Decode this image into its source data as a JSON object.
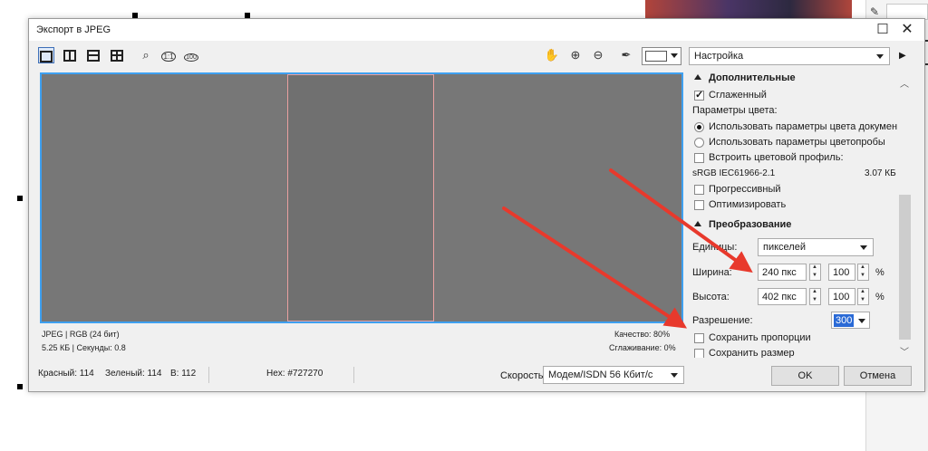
{
  "dialog": {
    "title": "Экспорт в JPEG",
    "close_label": "✕",
    "maximize_label": "☐"
  },
  "toolbar": {
    "preset": "Настройка",
    "icons": [
      "single-view-icon",
      "split-vertical-icon",
      "split-horizontal-icon",
      "quad-view-icon",
      "zoom-fit-icon",
      "zoom-1-1-icon",
      "zoom-100-icon",
      "pan-hand-icon",
      "zoom-in-icon",
      "zoom-out-icon",
      "eyedropper-icon"
    ],
    "zoom_1_1": "1:1",
    "zoom_100": "100"
  },
  "preview_info": {
    "format": "JPEG  |  RGB (24 бит)",
    "size": "5.25 КБ  |  Секунды: 0.8",
    "quality": "Качество: 80%",
    "smoothing": "Сглаживание: 0%"
  },
  "properties": {
    "section_additional": "Дополнительные",
    "antialiased": "Сглаженный",
    "color_params": "Параметры цвета:",
    "use_doc_colors": "Использовать параметры цвета документа",
    "use_proof_colors": "Использовать параметры цветопробы",
    "embed_profile": "Встроить цветовой профиль:",
    "profile_name": "sRGB IEC61966-2.1",
    "profile_size": "3.07 КБ",
    "progressive": "Прогрессивный",
    "optimize": "Оптимизировать",
    "section_transform": "Преобразование",
    "units_label": "Единицы:",
    "units_value": "пикселей",
    "width_label": "Ширина:",
    "width_value": "240 пкс",
    "width_percent": "100",
    "height_label": "Высота:",
    "height_value": "402 пкс",
    "height_percent": "100",
    "percent_sign": "%",
    "resolution_label": "Разрешение:",
    "resolution_value": "300",
    "keep_proportions": "Сохранить пропорции",
    "keep_size": "Сохранить размер"
  },
  "status": {
    "red": "Красный: 114",
    "green": "Зеленый: 114",
    "blue": "В: 112",
    "hex": "Hex: #727270",
    "speed_label": "Скорость:",
    "speed_value": "Модем/ISDN 56 Кбит/с"
  },
  "buttons": {
    "ok": "OK",
    "cancel": "Отмена"
  },
  "colors": {
    "preview_bg": "#777777",
    "accent_border": "#3ea0f0",
    "annotation_arrow": "#e8392c",
    "selection": "#2a6ad6"
  }
}
